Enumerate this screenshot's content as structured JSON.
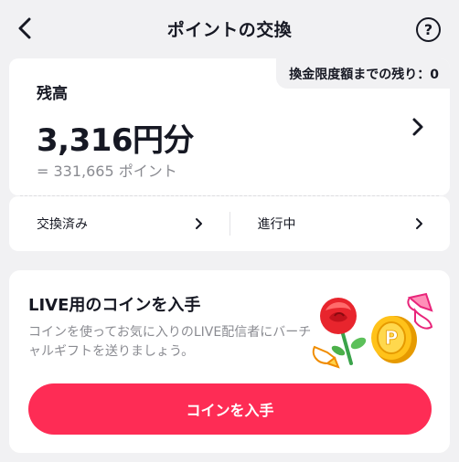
{
  "header": {
    "title": "ポイントの交換",
    "help_glyph": "?"
  },
  "balance": {
    "limit_text": "換金限度額までの残り：0",
    "label": "残高",
    "amount": "3,316円分",
    "points": "= 331,665 ポイント"
  },
  "history": {
    "exchanged_label": "交換済み",
    "in_progress_label": "進行中"
  },
  "coin": {
    "title": "LIVE用のコインを入手",
    "description": "コインを使ってお気に入りのLIVE配信者にバーチャルギフトを送りましょう。",
    "button_label": "コインを入手",
    "coin_symbol": "P"
  },
  "icons": {
    "back": "chevron-left-icon",
    "help": "question-circle-icon",
    "chevron": "chevron-right-icon",
    "rose": "rose-icon",
    "coin": "coin-icon"
  },
  "colors": {
    "accent": "#fe2c55",
    "background": "#f1f1f3",
    "card": "#ffffff",
    "muted_text": "#8a8b91",
    "coin_gold": "#f5b800",
    "rose_red": "#e8252d"
  }
}
